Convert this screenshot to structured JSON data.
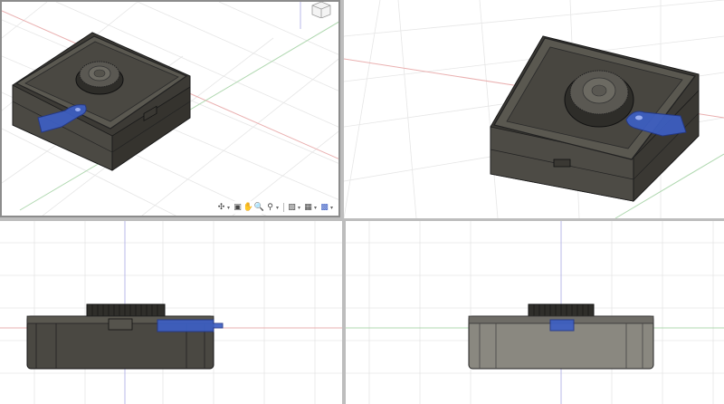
{
  "app": {
    "title": ""
  },
  "viewports": [
    {
      "id": "top-left",
      "view": "perspective-home"
    },
    {
      "id": "top-right",
      "view": "perspective"
    },
    {
      "id": "bottom-left",
      "view": "front"
    },
    {
      "id": "bottom-right",
      "view": "side"
    }
  ],
  "navigation_toolbar": {
    "items": [
      {
        "name": "orbit-icon",
        "dropdown": true
      },
      {
        "name": "look-at-icon",
        "dropdown": false
      },
      {
        "name": "pan-icon",
        "dropdown": false
      },
      {
        "name": "zoom-icon",
        "dropdown": false
      },
      {
        "name": "fit-icon",
        "dropdown": true
      },
      {
        "name": "display-settings-icon",
        "dropdown": true
      },
      {
        "name": "grid-settings-icon",
        "dropdown": true
      },
      {
        "name": "viewports-icon",
        "dropdown": true
      }
    ]
  },
  "colors": {
    "body_dark": "#4a4842",
    "body_light": "#8a8880",
    "edge": "#1e1e1e",
    "highlight_part": "#3d5fc4",
    "grid_line": "#e3e3e3",
    "axis_red": "#e8a8a8",
    "axis_green": "#a8d8a8",
    "axis_blue": "#b8b8e8",
    "viewport_border": "#8c8c8c"
  }
}
